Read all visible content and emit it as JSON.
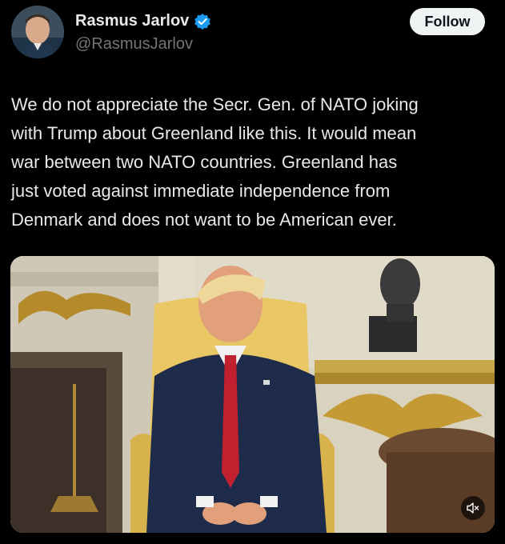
{
  "author": {
    "name": "Rasmus Jarlov",
    "handle": "@RasmusJarlov",
    "verified": true
  },
  "follow_label": "Follow",
  "tweet": {
    "lines": [
      "We do not appreciate the Secr. Gen. of NATO joking",
      "with Trump about Greenland like this. It would mean",
      "war between two NATO countries. Greenland has",
      "just voted against immediate independence from",
      "Denmark and does not want to be American ever."
    ]
  },
  "icons": {
    "verified": "verified-badge-icon",
    "mute": "speaker-muted-icon"
  },
  "colors": {
    "background": "#000000",
    "text": "#e7e9ea",
    "secondary_text": "#71767b",
    "verified_blue": "#1d9bf0",
    "follow_bg": "#eff3f4"
  }
}
